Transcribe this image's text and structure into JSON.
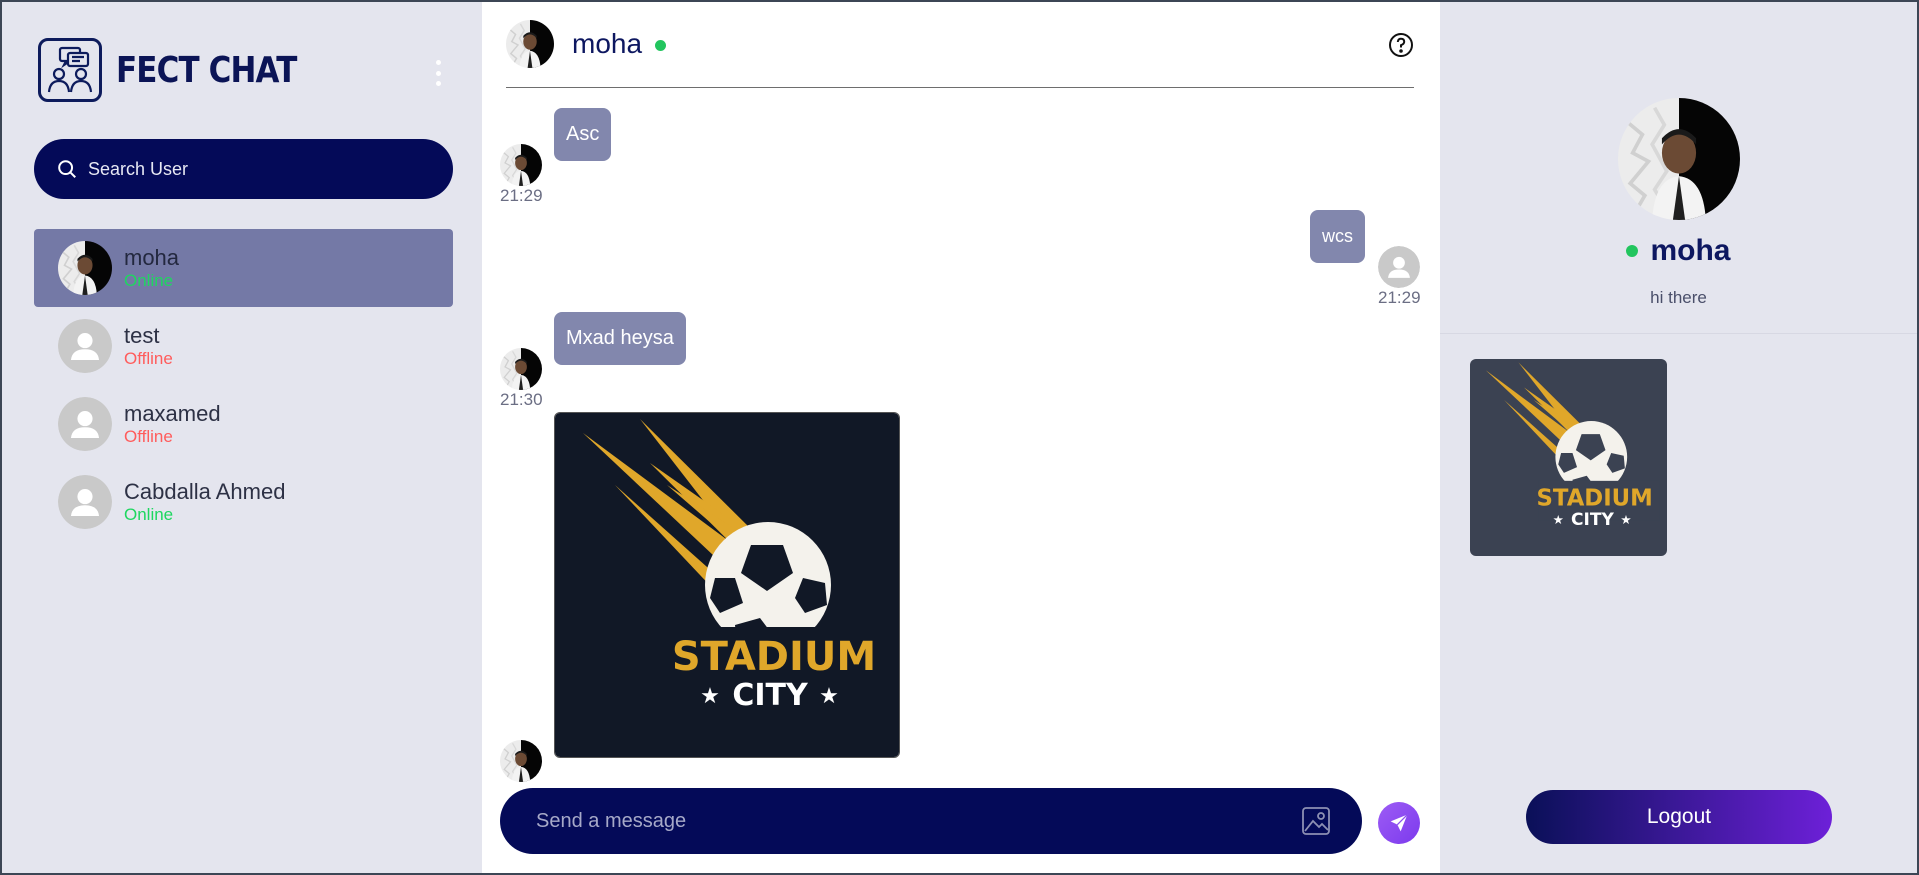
{
  "app": {
    "name": "FECT CHAT"
  },
  "search": {
    "placeholder": "Search User"
  },
  "users": [
    {
      "name": "moha",
      "status": "Online",
      "active": true,
      "avatar": "photo"
    },
    {
      "name": "test",
      "status": "Offline",
      "active": false,
      "avatar": "default"
    },
    {
      "name": "maxamed",
      "status": "Offline",
      "active": false,
      "avatar": "default"
    },
    {
      "name": "Cabdalla Ahmed",
      "status": "Online",
      "active": false,
      "avatar": "default"
    }
  ],
  "chat": {
    "contact_name": "moha",
    "contact_online": true,
    "messages": [
      {
        "direction": "incoming",
        "type": "text",
        "text": "Asc",
        "time": "21:29"
      },
      {
        "direction": "outgoing",
        "type": "text",
        "text": "wcs",
        "time": "21:29"
      },
      {
        "direction": "incoming",
        "type": "text",
        "text": "Mxad heysa",
        "time": "21:30"
      },
      {
        "direction": "incoming",
        "type": "image",
        "image_text_1": "STADIUM",
        "image_text_2": "CITY"
      }
    ],
    "composer_placeholder": "Send a message"
  },
  "profile": {
    "name": "moha",
    "bio": "hi there",
    "online": true,
    "media_text_1": "STADIUM",
    "media_text_2": "CITY"
  },
  "logout_label": "Logout",
  "colors": {
    "navy": "#040a58",
    "accent_purple": "#7c3aed",
    "online_green": "#22c55e",
    "offline_red": "#ff5c5c",
    "bubble": "#8287ad",
    "active_row": "#7479a6"
  },
  "icons": [
    "chat-logo-icon",
    "kebab-menu-icon",
    "search-icon",
    "help-icon",
    "image-upload-icon",
    "send-icon",
    "default-user-icon"
  ]
}
